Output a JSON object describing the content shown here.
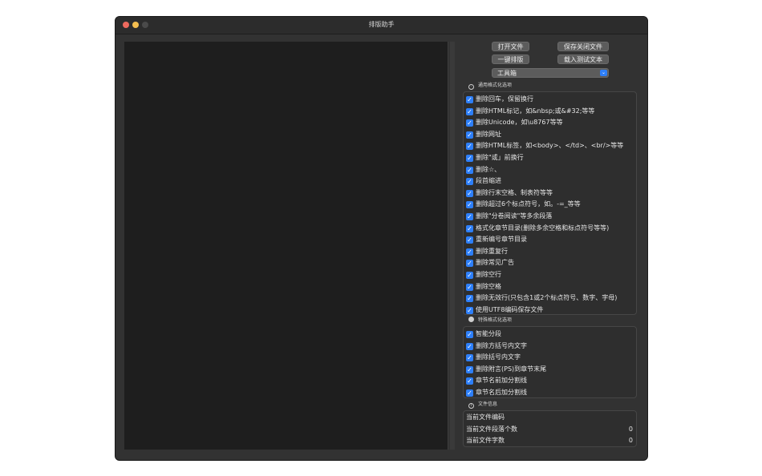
{
  "window": {
    "title": "排版助手"
  },
  "toolbar": {
    "open_file": "打开文件",
    "save_close": "保存关闭文件",
    "one_click": "一键排版",
    "load_test": "载入测试文本",
    "toolbox": "工具箱"
  },
  "general": {
    "header": "通用格式化选项",
    "options": [
      "删除回车，保留换行",
      "删除HTML标记，如&nbsp;或&#32;等等",
      "删除Unicode，如\\u8767等等",
      "删除网址",
      "删除HTML标签，如<body>、</td>、<br/>等等",
      "删除\"或」前换行",
      "删除☆、",
      "段首缩进",
      "删除行末空格、制表符等等",
      "删除超过6个标点符号，如。-=_等等",
      "删除\"分卷阅读\"等多余段落",
      "格式化章节目录(删除多余空格和标点符号等等)",
      "重新编号章节目录",
      "删除重复行",
      "删除常见广告",
      "删除空行",
      "删除空格",
      "删除无效行(只包含1或2个标点符号、数字、字母)",
      "使用UTF8编码保存文件"
    ]
  },
  "special": {
    "header": "特殊格式化选项",
    "options": [
      "智能分段",
      "删除方括号内文字",
      "删除括号内文字",
      "删除附言(PS)到章节末尾",
      "章节名前加分割线",
      "章节名后加分割线"
    ]
  },
  "info": {
    "header": "文件信息",
    "rows": [
      {
        "label": "当前文件编码",
        "value": ""
      },
      {
        "label": "当前文件段落个数",
        "value": "0"
      },
      {
        "label": "当前文件字数",
        "value": "0"
      }
    ]
  },
  "colors": {
    "accent": "#2d7ff9",
    "window_bg": "#323232",
    "editor_bg": "#1e1e1e"
  }
}
